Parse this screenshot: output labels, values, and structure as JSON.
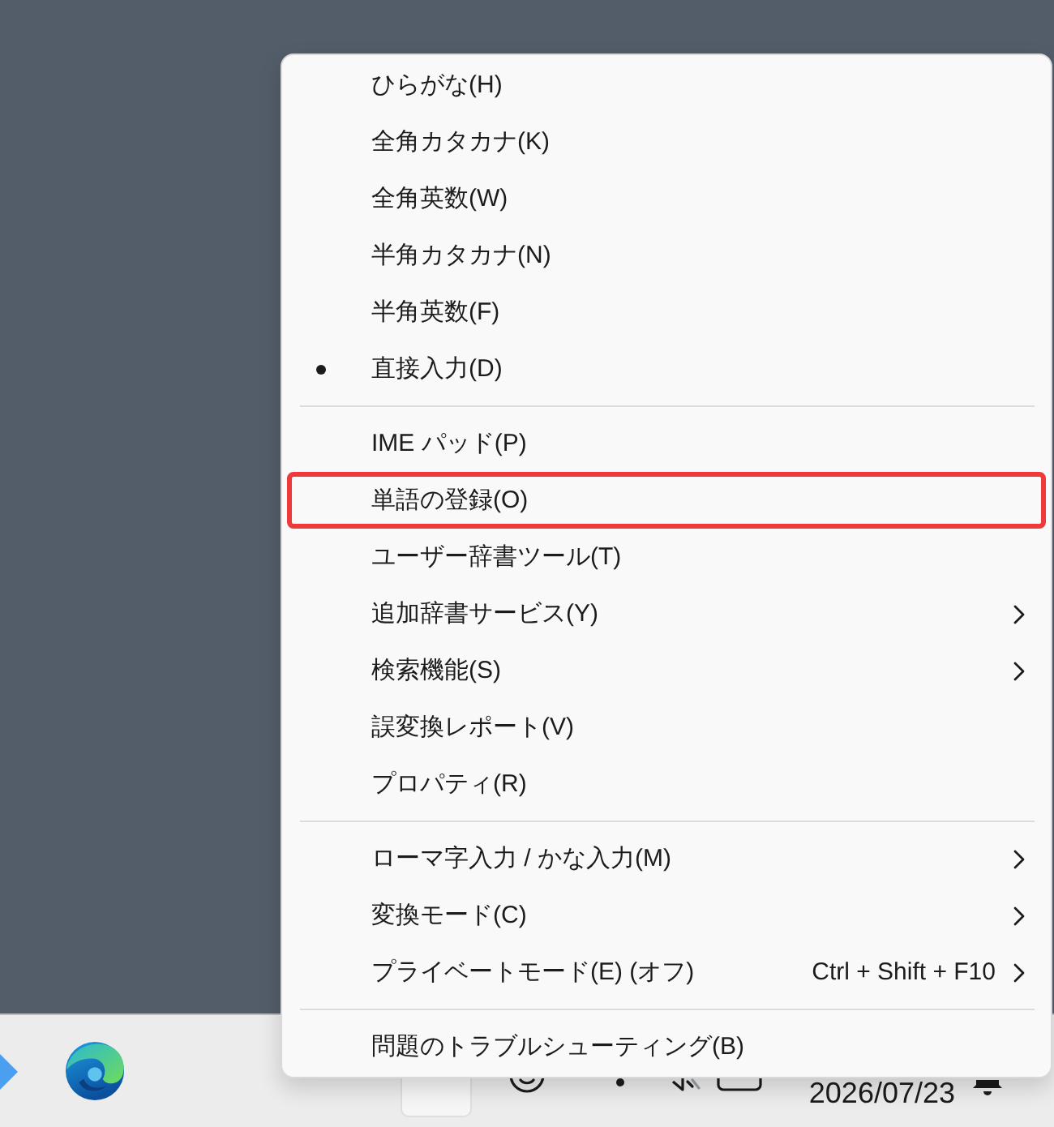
{
  "context_menu": {
    "sections": [
      {
        "items": [
          {
            "label": "ひらがな(H)",
            "selected": false,
            "submenu": false,
            "highlighted": false
          },
          {
            "label": "全角カタカナ(K)",
            "selected": false,
            "submenu": false,
            "highlighted": false
          },
          {
            "label": "全角英数(W)",
            "selected": false,
            "submenu": false,
            "highlighted": false
          },
          {
            "label": "半角カタカナ(N)",
            "selected": false,
            "submenu": false,
            "highlighted": false
          },
          {
            "label": "半角英数(F)",
            "selected": false,
            "submenu": false,
            "highlighted": false
          },
          {
            "label": "直接入力(D)",
            "selected": true,
            "submenu": false,
            "highlighted": false
          }
        ]
      },
      {
        "items": [
          {
            "label": "IME パッド(P)",
            "submenu": false,
            "highlighted": false
          },
          {
            "label": "単語の登録(O)",
            "submenu": false,
            "highlighted": true
          },
          {
            "label": "ユーザー辞書ツール(T)",
            "submenu": false,
            "highlighted": false
          },
          {
            "label": "追加辞書サービス(Y)",
            "submenu": true,
            "highlighted": false
          },
          {
            "label": "検索機能(S)",
            "submenu": true,
            "highlighted": false
          },
          {
            "label": "誤変換レポート(V)",
            "submenu": false,
            "highlighted": false
          },
          {
            "label": "プロパティ(R)",
            "submenu": false,
            "highlighted": false
          }
        ]
      },
      {
        "items": [
          {
            "label": "ローマ字入力 / かな入力(M)",
            "submenu": true,
            "highlighted": false
          },
          {
            "label": "変換モード(C)",
            "submenu": true,
            "highlighted": false
          },
          {
            "label": "プライベートモード(E) (オフ)",
            "shortcut": "Ctrl + Shift + F10",
            "submenu": true,
            "highlighted": false
          }
        ]
      },
      {
        "items": [
          {
            "label": "問題のトラブルシューティング(B)",
            "submenu": false,
            "highlighted": false
          }
        ]
      }
    ]
  },
  "taskbar": {
    "date": "2026/07/23"
  }
}
